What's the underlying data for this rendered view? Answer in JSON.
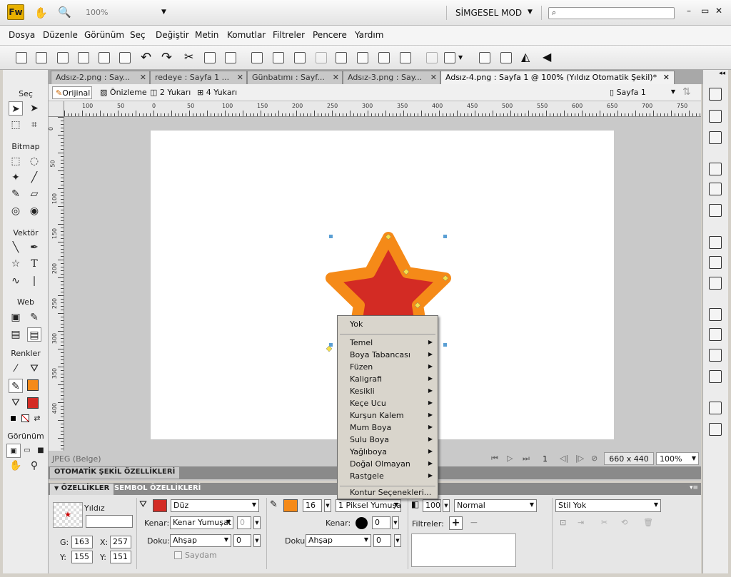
{
  "app": {
    "logo": "Fw",
    "zoom": "100%",
    "mode": "SİMGESEL MOD"
  },
  "menu": [
    "Dosya",
    "Düzenle",
    "Görünüm",
    "Seç",
    "Değiştir",
    "Metin",
    "Komutlar",
    "Filtreler",
    "Pencere",
    "Yardım"
  ],
  "tabs": [
    "Adsız-2.png : Say...",
    "redeye : Sayfa 1 ...",
    "Günbatımı : Sayf...",
    "Adsız-3.png : Say...",
    "Adsız-4.png : Sayfa 1 @ 100% (Yıldız Otomatik Şekil)*"
  ],
  "viewbar": {
    "original": "Orijinal",
    "preview": "Önizleme",
    "two_up": "2 Yukarı",
    "four_up": "4 Yukarı",
    "page": "Sayfa 1"
  },
  "ruler_h": [
    "100",
    "50",
    "0",
    "50",
    "100",
    "150",
    "200",
    "250",
    "300",
    "350",
    "400",
    "450",
    "500",
    "550",
    "600",
    "650",
    "700",
    "750"
  ],
  "ruler_v": [
    "0",
    "50",
    "100",
    "150",
    "200",
    "250",
    "300",
    "350",
    "400"
  ],
  "tools": {
    "select": "Seç",
    "bitmap": "Bitmap",
    "vector": "Vektör",
    "web": "Web",
    "colors": "Renkler",
    "view": "Görünüm"
  },
  "status": {
    "format": "JPEG (Belge)",
    "page_num": "1",
    "size": "660 x 440",
    "zoom": "100%"
  },
  "panels": {
    "auto_shape": "OTOMATİK ŞEKİL ÖZELLİKLERİ",
    "properties": "ÖZELLİKLER",
    "symbol": "SEMBOL ÖZELLİKLERİ"
  },
  "props": {
    "object": "Yıldız",
    "g_label": "G:",
    "g": "163",
    "x_label": "X:",
    "x": "257",
    "y_label": "Y:",
    "y": "155",
    "h_label": "Y:",
    "h": "151",
    "fill_type": "Düz",
    "edge_label": "Kenar:",
    "edge": "Kenar Yumuşat",
    "edge_val": "0",
    "texture_label": "Doku:",
    "texture": "Ahşap",
    "texture_val": "0",
    "transparent": "Saydam",
    "stroke_size": "16",
    "stroke_type": "1 Piksel Yumuşa",
    "s_edge_label": "Kenar:",
    "s_edge_val": "0",
    "s_texture_label": "Doku:",
    "s_texture": "Ahşap",
    "s_texture_val": "0",
    "opacity": "100",
    "blend": "Normal",
    "filters_label": "Filtreler:",
    "style": "Stil Yok"
  },
  "colors": {
    "fill": "#d32b24",
    "stroke": "#f58a18"
  },
  "context_menu": {
    "top": "Yok",
    "items": [
      "Temel",
      "Boya Tabancası",
      "Füzen",
      "Kaligrafi",
      "Kesikli",
      "Keçe Ucu",
      "Kurşun Kalem",
      "Mum Boya",
      "Sulu Boya",
      "Yağlıboya",
      "Doğal Olmayan",
      "Rastgele"
    ],
    "bottom": "Kontur Seçenekleri..."
  }
}
